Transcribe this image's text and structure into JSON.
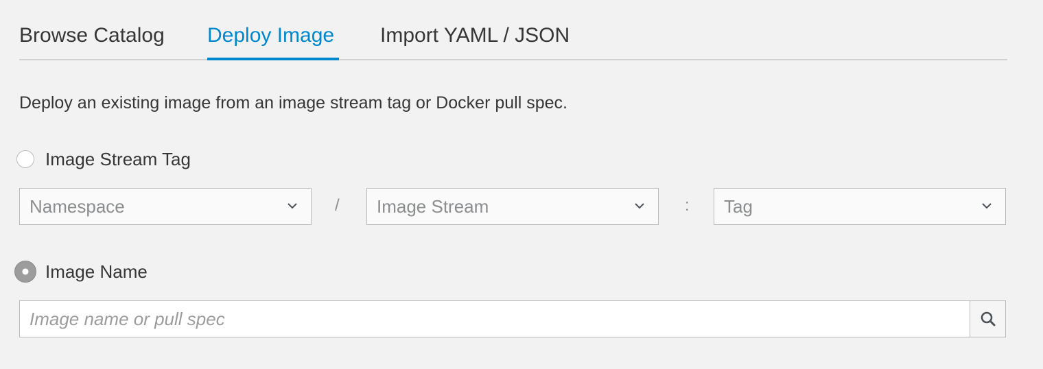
{
  "tabs": {
    "browse": "Browse Catalog",
    "deploy": "Deploy Image",
    "import": "Import YAML / JSON",
    "active": "deploy"
  },
  "description": "Deploy an existing image from an image stream tag or Docker pull spec.",
  "image_stream_tag": {
    "label": "Image Stream Tag",
    "selected": false,
    "namespace_placeholder": "Namespace",
    "image_stream_placeholder": "Image Stream",
    "tag_placeholder": "Tag",
    "separator_slash": "/",
    "separator_colon": ":"
  },
  "image_name": {
    "label": "Image Name",
    "selected": true,
    "placeholder": "Image name or pull spec",
    "value": ""
  },
  "icons": {
    "dropdown": "chevron-down-icon",
    "search": "search-icon"
  },
  "colors": {
    "accent": "#0088ce",
    "background": "#f2f2f2"
  }
}
